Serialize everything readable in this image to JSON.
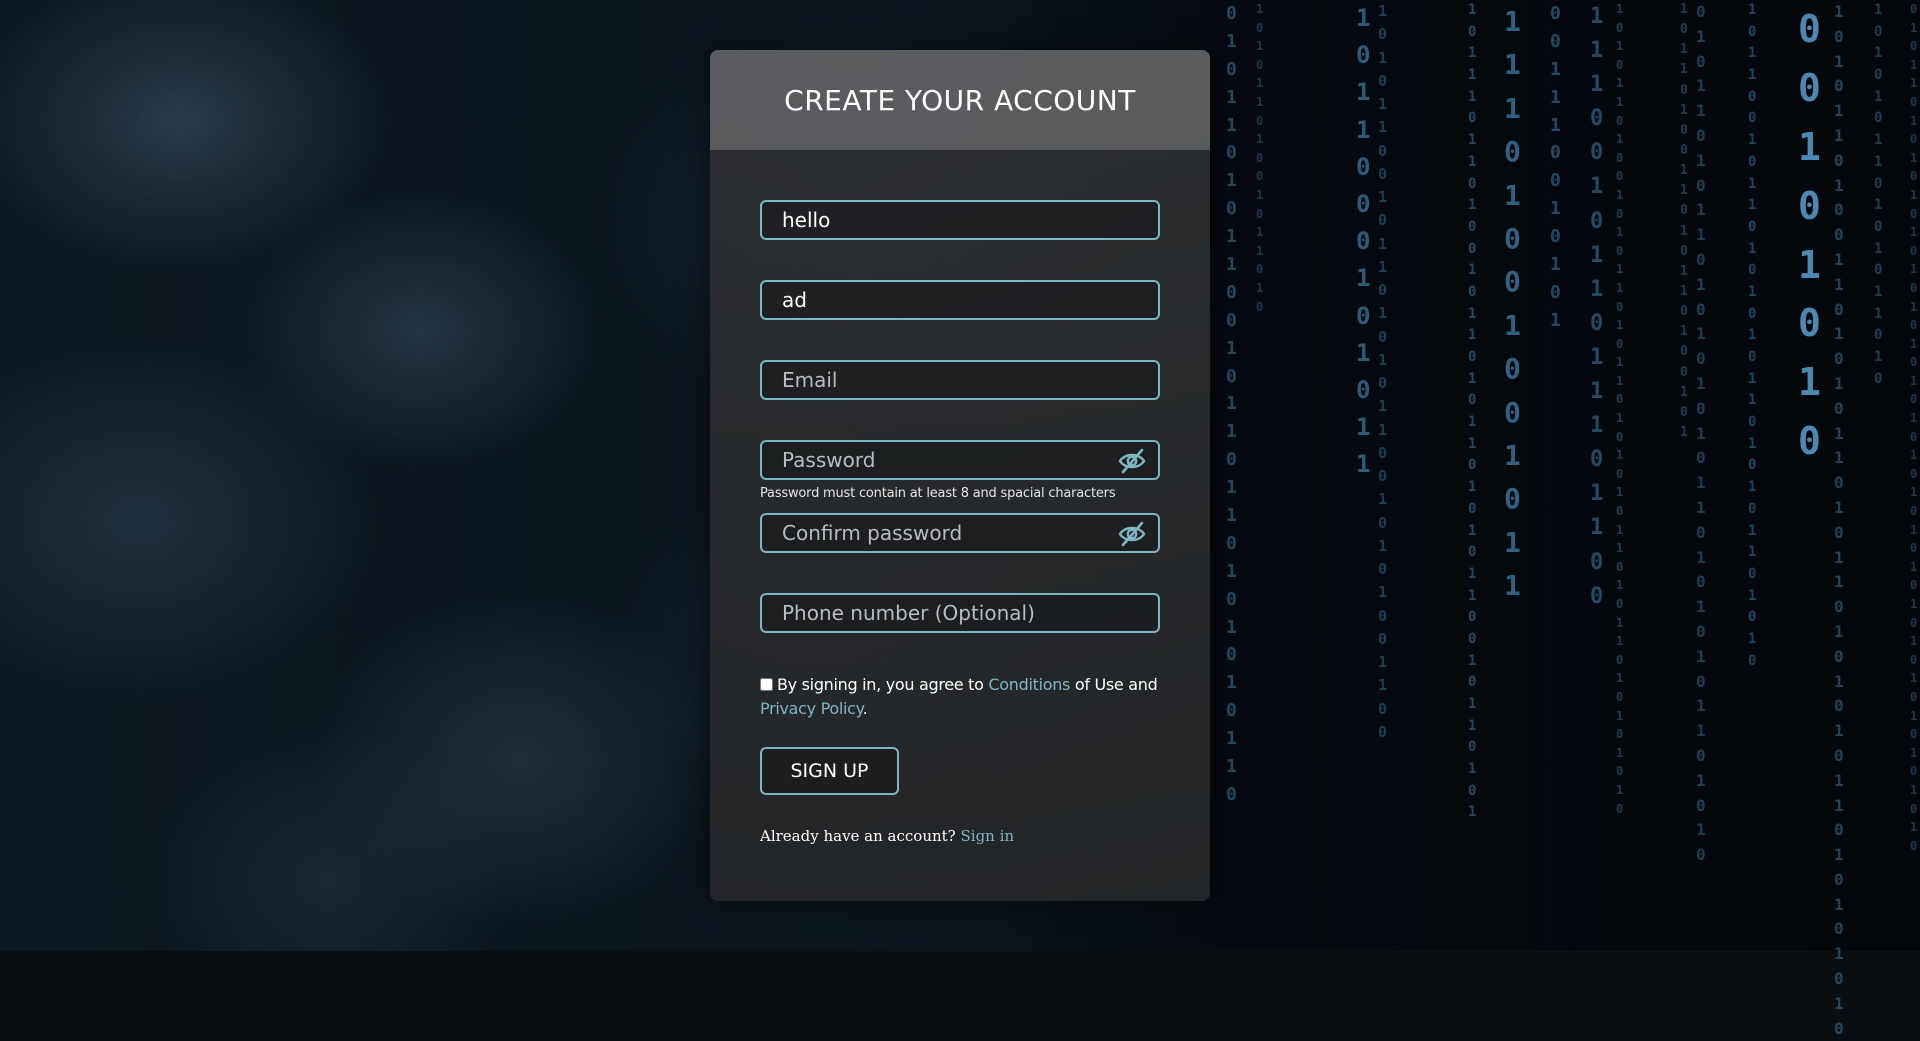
{
  "page": {
    "title": "CREATE YOUR ACCOUNT"
  },
  "form": {
    "first_field": {
      "value": "hello",
      "placeholder": ""
    },
    "second_field": {
      "value": "ad",
      "placeholder": ""
    },
    "email": {
      "value": "",
      "placeholder": "Email"
    },
    "password": {
      "value": "",
      "placeholder": "Password",
      "hint": "Password must contain at least 8 and spacial characters"
    },
    "confirm_password": {
      "value": "",
      "placeholder": "Confirm password"
    },
    "phone": {
      "value": "",
      "placeholder": "Phone number (Optional)"
    },
    "agree": {
      "prefix": "By signing in, you agree to ",
      "conditions_link": "Conditions",
      "middle": " of Use and ",
      "privacy_link": "Privacy Policy",
      "suffix": ".",
      "checked": false
    },
    "signup_label": "SIGN UP",
    "signin_prompt": "Already have an account? ",
    "signin_link": "Sign in"
  },
  "icons": {
    "password_toggle": "eye-slash-icon",
    "confirm_toggle": "eye-slash-icon"
  },
  "colors": {
    "accent": "#7fb6c4",
    "card": "#2c2e30",
    "matrix": "#3f7fa8"
  }
}
